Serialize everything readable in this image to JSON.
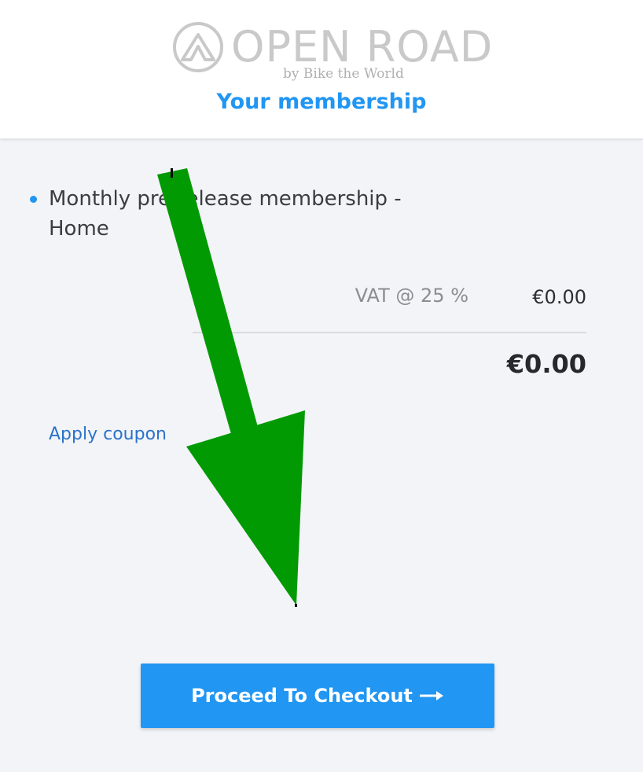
{
  "header": {
    "logo": {
      "brand": "OPEN ROAD",
      "tagline": "by Bike the World",
      "icon": "open-road-logo-icon"
    },
    "title": "Your membership"
  },
  "cart": {
    "items": [
      {
        "label": "Monthly pre-release membership - Home"
      }
    ],
    "vat_label": "VAT @ 25 %",
    "vat_value": "€0.00",
    "total_value": "€0.00",
    "apply_coupon_label": "Apply coupon"
  },
  "checkout": {
    "label": "Proceed To Checkout",
    "icon": "long-arrow-right-icon"
  },
  "annotation": {
    "icon": "green-down-arrow-annotation",
    "color": "#029a02"
  },
  "colors": {
    "accent": "#2196f3",
    "link": "#2a73c9",
    "background": "#f3f4f8"
  }
}
